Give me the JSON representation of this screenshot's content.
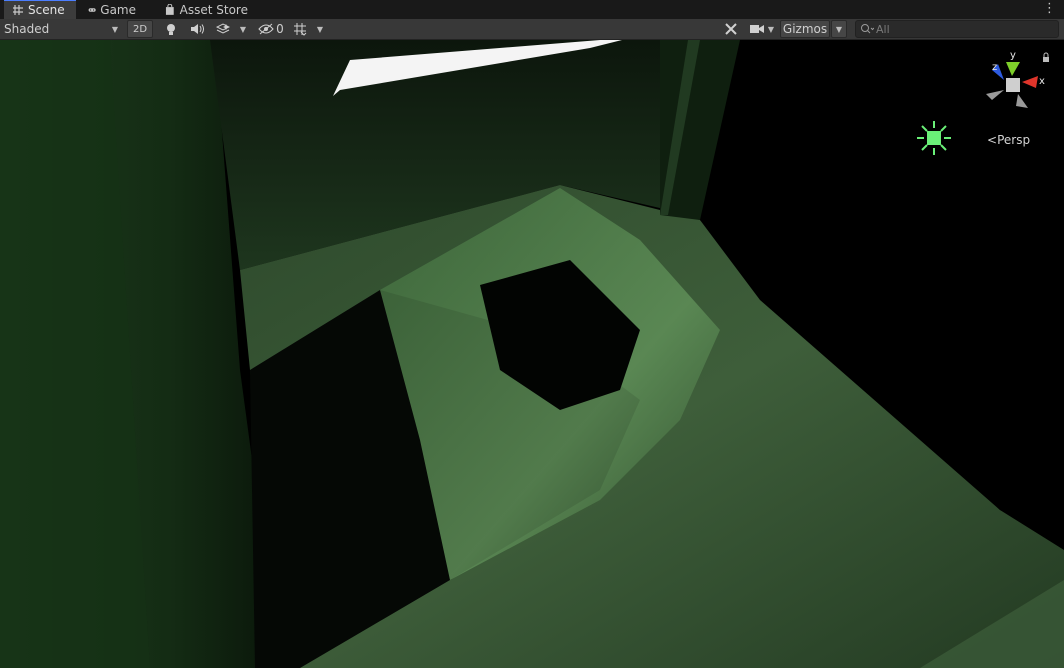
{
  "tabs": [
    {
      "label": "Scene",
      "icon": "scene-grid-icon",
      "active": true
    },
    {
      "label": "Game",
      "icon": "gamepad-icon",
      "active": false
    },
    {
      "label": "Asset Store",
      "icon": "shopping-bag-icon",
      "active": false
    }
  ],
  "toolbar": {
    "draw_mode": "Shaded",
    "mode_2d_label": "2D",
    "hidden_count": "0",
    "gizmos_label": "Gizmos",
    "search_placeholder": "All"
  },
  "viewport": {
    "projection_label": "Persp",
    "axis_labels": {
      "x": "x",
      "y": "y",
      "z": "z"
    },
    "colors": {
      "x_axis": "#e0352b",
      "y_axis": "#7ecf2a",
      "z_axis": "#2d5be0",
      "light_gizmo": "#6af078"
    }
  }
}
